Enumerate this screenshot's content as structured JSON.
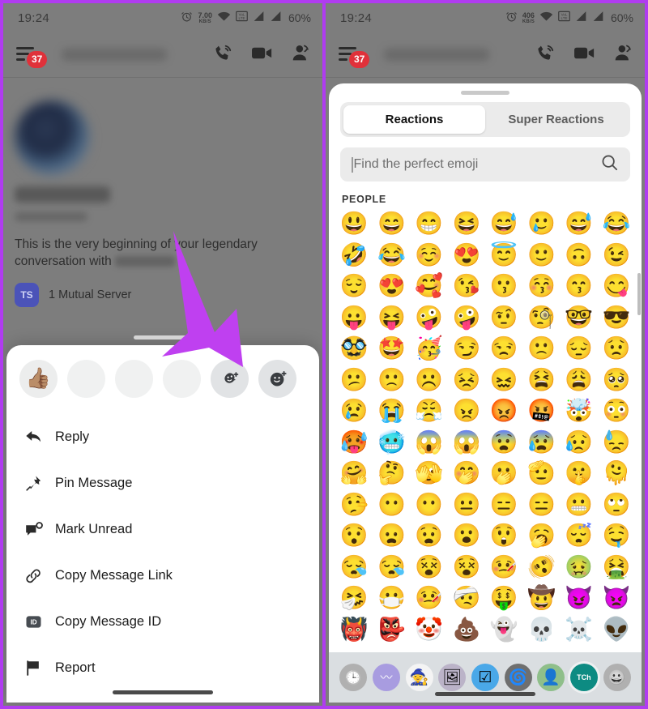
{
  "annotation": {
    "arrow_color": "#bf40f0",
    "highlight_border_color": "#b03cf0"
  },
  "left_panel": {
    "status_bar": {
      "time": "19:24",
      "net_speed_value": "7.00",
      "net_speed_unit": "KB/S",
      "battery": "60%",
      "icons": [
        "alarm-icon",
        "wifi-icon",
        "volte-icon",
        "signal-one-icon",
        "signal-two-icon"
      ]
    },
    "app_bar": {
      "unread_badge": "37",
      "title_blurred": "",
      "actions": [
        "voice-call-icon",
        "video-call-icon",
        "add-friend-icon"
      ]
    },
    "conversation": {
      "name_blurred": "",
      "intro_line_1": "This is the very beginning of your",
      "intro_line_1_end": "legendary",
      "intro_line_2": "conversation with",
      "mutual_initials": "TS",
      "mutual_label": "1 Mutual Server"
    },
    "context_sheet": {
      "reactions": [
        {
          "name": "thumbs-up-reaction",
          "glyph": "👍🏽",
          "style": "emoji"
        },
        {
          "name": "reaction-slot-2",
          "glyph": "",
          "style": "empty"
        },
        {
          "name": "reaction-slot-3",
          "glyph": "",
          "style": "empty"
        },
        {
          "name": "reaction-slot-4",
          "glyph": "",
          "style": "empty"
        },
        {
          "name": "add-super-reaction-button",
          "glyph": "",
          "style": "glyph-burst"
        },
        {
          "name": "add-reaction-button",
          "glyph": "",
          "style": "glyph-smiley"
        }
      ],
      "menu": [
        {
          "icon": "reply-arrow-icon",
          "label": "Reply"
        },
        {
          "icon": "pin-icon",
          "label": "Pin Message"
        },
        {
          "icon": "mark-unread-icon",
          "label": "Mark Unread"
        },
        {
          "icon": "link-icon",
          "label": "Copy Message Link"
        },
        {
          "icon": "id-badge-icon",
          "label": "Copy Message ID"
        },
        {
          "icon": "flag-icon",
          "label": "Report"
        }
      ]
    }
  },
  "right_panel": {
    "status_bar": {
      "time": "19:24",
      "net_speed_value": "406",
      "net_speed_unit": "KB/S",
      "battery": "60%"
    },
    "app_bar": {
      "unread_badge": "37"
    },
    "emoji_sheet": {
      "tabs": [
        {
          "label": "Reactions",
          "active": true
        },
        {
          "label": "Super Reactions",
          "active": false
        }
      ],
      "search": {
        "value": "",
        "placeholder": "Find the perfect emoji",
        "icon": "search-icon"
      },
      "category_title": "PEOPLE",
      "emoji_rows": [
        [
          "😃",
          "😄",
          "😁",
          "😆",
          "😅",
          "🥲",
          "😅",
          "😂"
        ],
        [
          "🤣",
          "😂",
          "☺️",
          "😍",
          "😇",
          "🙂",
          "🙃",
          "😉"
        ],
        [
          "😌",
          "😍",
          "🥰",
          "😘",
          "😗",
          "😚",
          "😙",
          "😋"
        ],
        [
          "😛",
          "😝",
          "🤪",
          "🤪",
          "🤨",
          "🧐",
          "🤓",
          "😎"
        ],
        [
          "🥸",
          "🤩",
          "🥳",
          "😏",
          "😒",
          "🙁",
          "😔",
          "😟"
        ],
        [
          "😕",
          "🙁",
          "☹️",
          "😣",
          "😖",
          "😫",
          "😩",
          "🥺"
        ],
        [
          "😢",
          "😭",
          "😤",
          "😠",
          "😡",
          "🤬",
          "🤯",
          "😳"
        ],
        [
          "🥵",
          "🥶",
          "😱",
          "😱",
          "😨",
          "😰",
          "😥",
          "😓"
        ],
        [
          "🤗",
          "🤔",
          "🫣",
          "🤭",
          "🫢",
          "🫡",
          "🤫",
          "🫠"
        ],
        [
          "🤥",
          "😶",
          "😶",
          "😐",
          "😑",
          "😑",
          "😬",
          "🙄"
        ],
        [
          "😯",
          "😦",
          "😧",
          "😮",
          "😲",
          "🥱",
          "😴",
          "🤤"
        ],
        [
          "😪",
          "😪",
          "😵",
          "😵",
          "🤒",
          "🫨",
          "🤢",
          "🤮"
        ],
        [
          "🤧",
          "😷",
          "🤒",
          "🤕",
          "🤑",
          "🤠",
          "😈",
          "👿"
        ],
        [
          "👹",
          "👺",
          "🤡",
          "💩",
          "👻",
          "💀",
          "☠️",
          "👽"
        ]
      ],
      "category_tabs": [
        {
          "name": "recent-emoji-tab",
          "glyph": "🕒",
          "kind": "clock"
        },
        {
          "name": "nitro-server-tab",
          "glyph": "",
          "kind": "wave"
        },
        {
          "name": "wizard-hat-server-tab",
          "glyph": "🧙",
          "kind": "img"
        },
        {
          "name": "portrait-server-tab",
          "glyph": "🖼",
          "kind": "img"
        },
        {
          "name": "checkbox-server-tab",
          "glyph": "☑",
          "kind": "img"
        },
        {
          "name": "spiral-server-tab",
          "glyph": "🌀",
          "kind": "img"
        },
        {
          "name": "avatar-server-tab",
          "glyph": "👤",
          "kind": "img"
        },
        {
          "name": "teal-server-tab",
          "glyph": "TCh",
          "kind": "text",
          "selected": true
        },
        {
          "name": "people-emoji-tab",
          "glyph": "😀",
          "kind": "face"
        }
      ]
    }
  }
}
